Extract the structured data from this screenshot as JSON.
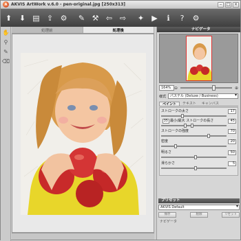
{
  "window": {
    "title": "AKVIS ArtWork v.6.0 - pen-original.jpg [250x313]",
    "logo_letter": "A"
  },
  "toolbar": {
    "icons": [
      "open-icon",
      "save-icon",
      "print-icon",
      "upload-icon",
      "batch-icon",
      "brush-icon",
      "settings-icon",
      "undo-icon",
      "redo-icon",
      "magic-wand-icon",
      "run-icon",
      "info-icon",
      "help-icon",
      "gear-icon"
    ]
  },
  "tabs": {
    "before": "処理前",
    "after": "処理後"
  },
  "navigator": {
    "title": "ナビゲータ",
    "zoom": "164%"
  },
  "style": {
    "label": "様式",
    "value": "パステル (Deluxe / Business)"
  },
  "subtabs": {
    "paint": "ペイント",
    "texture": "テキスト",
    "canvas": "キャンバス"
  },
  "params": {
    "stroke_size_label": "ストロークの太さ",
    "stroke_size": "17",
    "min_len_label": "最小/最大 ストロークの長さ",
    "min_len": "35",
    "max_len": "45",
    "stroke_density_label": "ストロークの強度",
    "stroke_density": "70",
    "density_label": "密度",
    "density": "20",
    "brightness_label": "明るさ",
    "brightness": "50",
    "smoothness_label": "滑らかさ",
    "smoothness": "5"
  },
  "presets": {
    "title": "プリセット",
    "value": "AKVIS Default",
    "save": "保存",
    "delete": "削除",
    "reset": "リセット"
  },
  "footer": {
    "navigator": "ナビゲータ"
  },
  "colors": {
    "toolbar": "#4a4a4a",
    "accent": "#c0381c"
  }
}
